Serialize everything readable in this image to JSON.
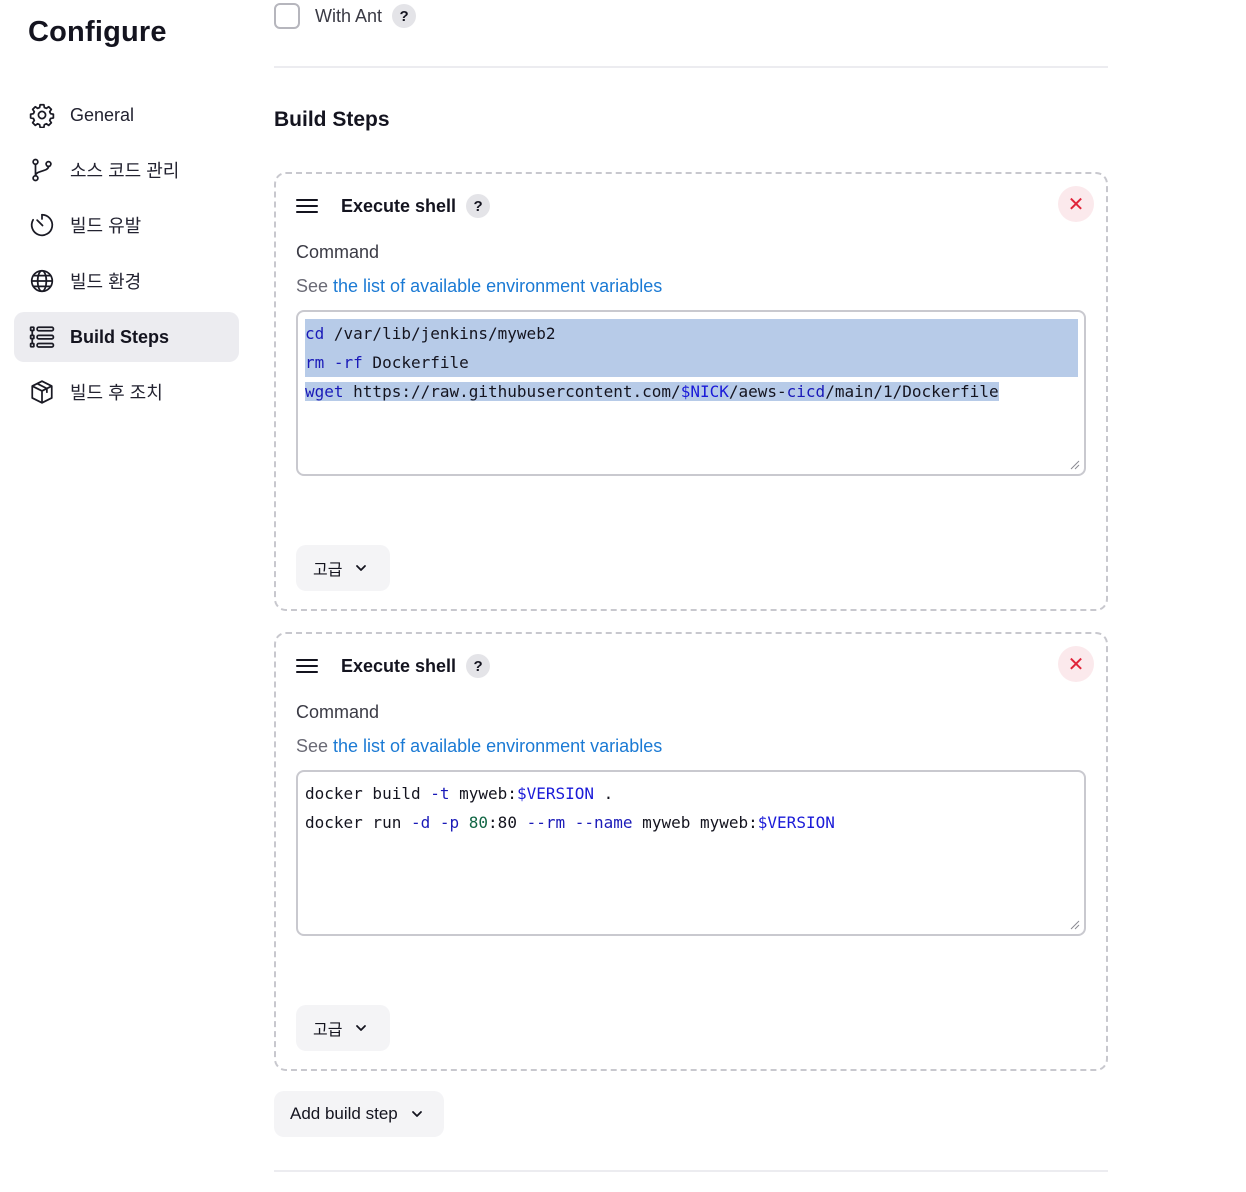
{
  "sidebar": {
    "title": "Configure",
    "items": [
      {
        "label": "General",
        "icon": "gear-icon"
      },
      {
        "label": "소스 코드 관리",
        "icon": "git-branch-icon"
      },
      {
        "label": "빌드 유발",
        "icon": "timer-icon"
      },
      {
        "label": "빌드 환경",
        "icon": "globe-icon"
      },
      {
        "label": "Build Steps",
        "icon": "list-icon",
        "active": true
      },
      {
        "label": "빌드 후 조치",
        "icon": "package-icon"
      }
    ]
  },
  "main": {
    "with_ant_label": "With Ant",
    "help_glyph": "?",
    "section_title": "Build Steps",
    "steps": [
      {
        "title": "Execute shell",
        "close_glyph": "✕",
        "command_label": "Command",
        "see_prefix": "See ",
        "see_link": "the list of available environment variables",
        "code": [
          {
            "kw": "cd",
            "rest": " /var/lib/jenkins/myweb2"
          },
          {
            "kw": "rm",
            "flag": " -rf",
            "rest": " Dockerfile"
          },
          {
            "kw": "wget",
            "url_a": " https://raw.githubusercontent.com/",
            "var": "$NICK",
            "url_b": "/aews-",
            "kw2": "cicd",
            "url_c": "/main/1/Dockerfile"
          }
        ],
        "advanced_label": "고급"
      },
      {
        "title": "Execute shell",
        "close_glyph": "✕",
        "command_label": "Command",
        "see_prefix": "See ",
        "see_link": "the list of available environment variables",
        "code": [
          {
            "a": "docker build ",
            "flag1": "-t",
            "b": " myweb:",
            "var": "$VERSION",
            "c": " ."
          },
          {
            "a": "docker run ",
            "flag1": "-d",
            "sp1": " ",
            "flag2": "-p",
            "sp2": " ",
            "num": "80",
            "b": ":80 ",
            "flag3": "--rm",
            "sp3": " ",
            "flag4": "--name",
            "c": " myweb myweb:",
            "var": "$VERSION"
          }
        ],
        "advanced_label": "고급"
      }
    ],
    "add_build_step_label": "Add build step"
  },
  "colors": {
    "accent_link": "#1b7ad4",
    "selection": "#b7cbe8",
    "close_bg": "#fbe9ec",
    "close_fg": "#e0243a",
    "active_nav_bg": "#ececf0"
  }
}
